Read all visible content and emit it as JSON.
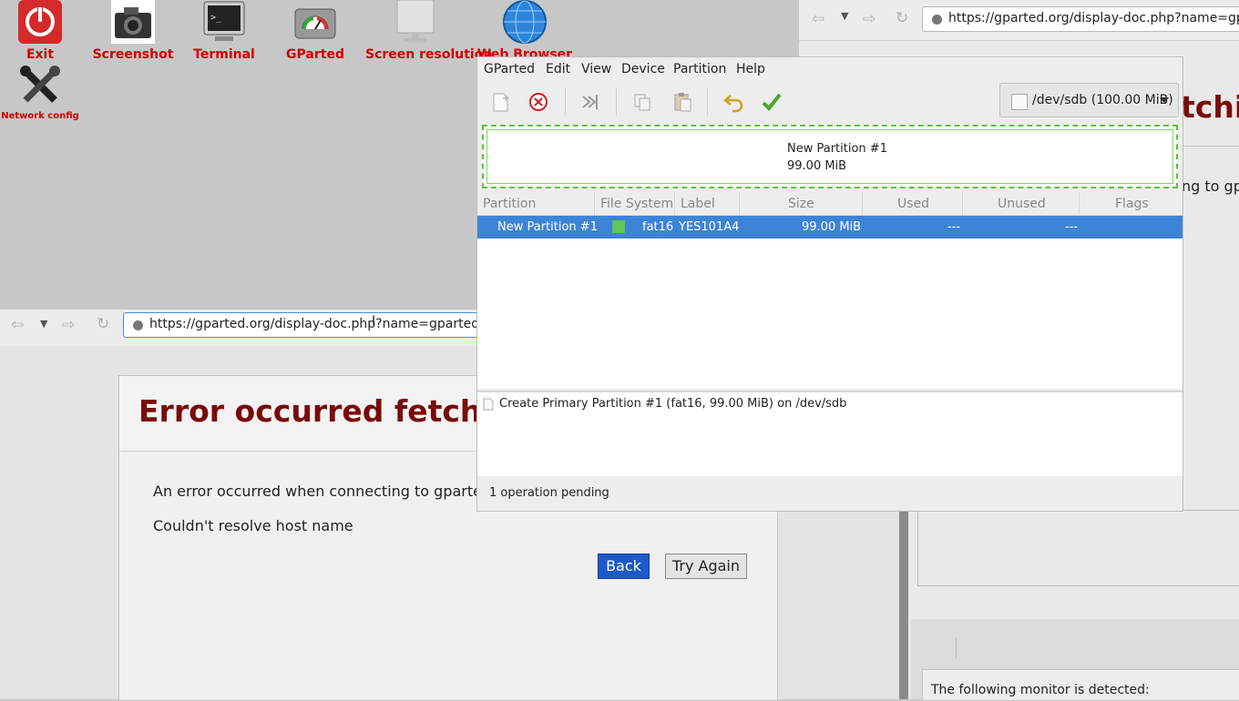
{
  "desktop": {
    "icons": [
      {
        "label": "Exit",
        "icon": "power-icon"
      },
      {
        "label": "Screenshot",
        "icon": "camera-icon"
      },
      {
        "label": "Terminal",
        "icon": "terminal-icon"
      },
      {
        "label": "GParted",
        "icon": "disk-gauge-icon"
      },
      {
        "label": "Screen resolution",
        "icon": "monitor-icon"
      },
      {
        "label": "Web Browser",
        "icon": "globe-icon"
      },
      {
        "label": "Network config",
        "icon": "tools-icon"
      }
    ]
  },
  "right_browser": {
    "url": "https://gparted.org/display-doc.php?name=gparted-live-manual",
    "heading_fragment": "tchi",
    "text_fragment": "ng to gp",
    "dialog_text": "The following monitor is detected:"
  },
  "left_browser": {
    "url": "https://gparted.org/display-doc.php?name=gparted-live-manual",
    "error_title": "Error occurred fetching",
    "error_message": "An error occurred when connecting to gparted",
    "error_detail": "Couldn't resolve host name",
    "back_label": "Back",
    "try_again_label": "Try Again"
  },
  "gparted": {
    "menu": [
      "GParted",
      "Edit",
      "View",
      "Device",
      "Partition",
      "Help"
    ],
    "device": "/dev/sdb (100.00 MiB)",
    "graph": {
      "name": "New Partition #1",
      "size": "99.00 MiB"
    },
    "columns": [
      "Partition",
      "File System",
      "Label",
      "Size",
      "Used",
      "Unused",
      "Flags"
    ],
    "rows": [
      {
        "partition": "New Partition #1",
        "fs": "fat16",
        "fs_color": "#5ec65b",
        "label": "YES101A4",
        "size": "99.00 MiB",
        "used": "---",
        "unused": "---",
        "flags": ""
      }
    ],
    "operations": [
      "Create Primary Partition #1 (fat16, 99.00 MiB) on /dev/sdb"
    ],
    "status": "1 operation pending"
  }
}
